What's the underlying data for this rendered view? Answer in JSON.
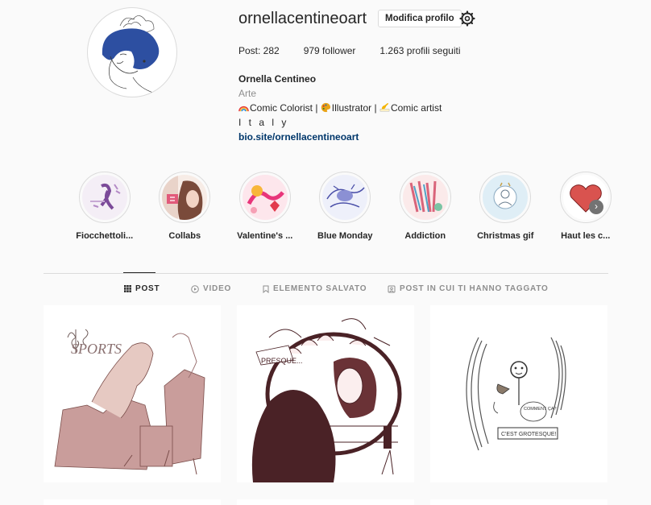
{
  "profile": {
    "username": "ornellacentineoart",
    "edit_label": "Modifica profilo",
    "stats": {
      "posts": "Post: 282",
      "followers": "979 follower",
      "following": "1.263 profili seguiti"
    },
    "name": "Ornella Centineo",
    "category": "Arte",
    "bio_line": "Comic Colorist | Illustrator | Comic artist",
    "bio_part1": "Comic Colorist | ",
    "bio_part2": "Illustrator | ",
    "bio_part3": "Comic artist",
    "location": "I t a l y",
    "link": "bio.site/ornellacentineoart"
  },
  "highlights": [
    {
      "label": "Fiocchettoli...",
      "icon": "purple-ribbon"
    },
    {
      "label": "Collabs",
      "icon": "girl-illustration"
    },
    {
      "label": "Valentine's ...",
      "icon": "valentine-art"
    },
    {
      "label": "Blue Monday",
      "icon": "blue-sketch"
    },
    {
      "label": "Addiction",
      "icon": "colorful-art"
    },
    {
      "label": "Christmas gif",
      "icon": "christmas-sketch"
    },
    {
      "label": "Haut les c...",
      "icon": "red-heart"
    }
  ],
  "tabs": [
    {
      "label": "POST",
      "icon": "grid-icon",
      "active": true
    },
    {
      "label": "VIDEO",
      "icon": "play-icon",
      "active": false
    },
    {
      "label": "ELEMENTO SALVATO",
      "icon": "bookmark-icon",
      "active": false
    },
    {
      "label": "POST IN CUI TI HANNO TAGGATO",
      "icon": "tag-icon",
      "active": false
    }
  ],
  "posts": [
    {
      "text": "SPORTS"
    },
    {
      "text": "PRESQUE..."
    },
    {
      "text": "C'EST GROTESQUE!",
      "bubble": "COMMENT ÇA?"
    }
  ],
  "colors": {
    "accent_link": "#00376b",
    "border": "#dbdbdb",
    "muted": "#8e8e8e",
    "avatar_blue": "#2d4fa1"
  }
}
